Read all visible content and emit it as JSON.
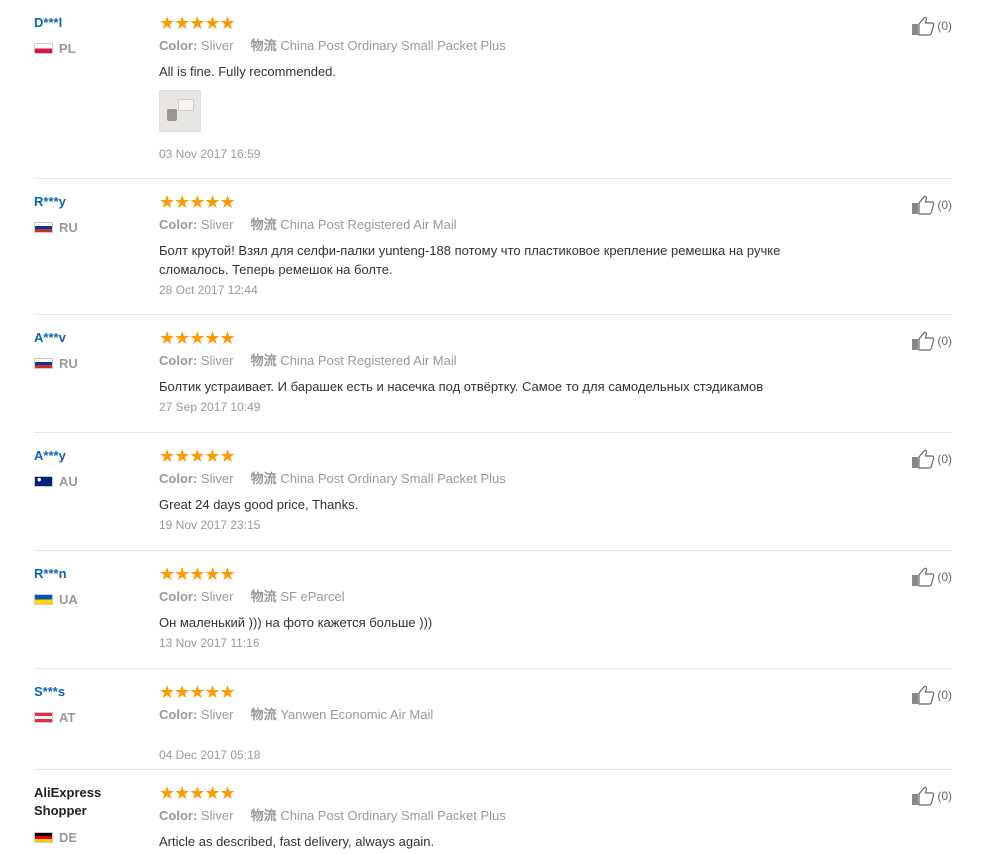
{
  "colors": {
    "username": "#0c64b4",
    "star": "#ff9a00",
    "muted": "#999999"
  },
  "reviews": [
    {
      "user": "D***l",
      "country": "PL",
      "flag": "pl",
      "stars": "★★★★★",
      "color_label": "Color:",
      "color_value": "Sliver",
      "logistics_label": "物流",
      "logistics_value": "China Post Ordinary Small Packet Plus",
      "text": "All is fine. Fully recommended.",
      "has_photo": true,
      "date": "03 Nov 2017 16:59",
      "likes": "(0)"
    },
    {
      "user": "R***y",
      "country": "RU",
      "flag": "ru",
      "stars": "★★★★★",
      "color_label": "Color:",
      "color_value": "Sliver",
      "logistics_label": "物流",
      "logistics_value": "China Post Registered Air Mail",
      "text": "Болт крутой! Взял для селфи-палки yunteng-188 потому что пластиковое крепление ремешка на ручке сломалось. Теперь ремешок на болте.",
      "date": "28 Oct 2017 12:44",
      "likes": "(0)"
    },
    {
      "user": "A***v",
      "country": "RU",
      "flag": "ru",
      "stars": "★★★★★",
      "color_label": "Color:",
      "color_value": "Sliver",
      "logistics_label": "物流",
      "logistics_value": "China Post Registered Air Mail",
      "text": "Болтик устраивает. И барашек есть и насечка под отвёртку. Самое то для самодельных стэдикамов",
      "date": "27 Sep 2017 10:49",
      "likes": "(0)"
    },
    {
      "user": "A***y",
      "country": "AU",
      "flag": "au",
      "stars": "★★★★★",
      "color_label": "Color:",
      "color_value": "Sliver",
      "logistics_label": "物流",
      "logistics_value": "China Post Ordinary Small Packet Plus",
      "text": "Great 24 days good price, Thanks.",
      "date": "19 Nov 2017 23:15",
      "likes": "(0)"
    },
    {
      "user": "R***n",
      "country": "UA",
      "flag": "ua",
      "stars": "★★★★★",
      "color_label": "Color:",
      "color_value": "Sliver",
      "logistics_label": "物流",
      "logistics_value": "SF eParcel",
      "text": "Он маленький ))) на фото кажется больше )))",
      "date": "13 Nov 2017 11:16",
      "likes": "(0)"
    },
    {
      "user": "S***s",
      "country": "AT",
      "flag": "at",
      "stars": "★★★★★",
      "color_label": "Color:",
      "color_value": "Sliver",
      "logistics_label": "物流",
      "logistics_value": "Yanwen Economic Air Mail",
      "text": "",
      "date": "04 Dec 2017 05:18",
      "likes": "(0)"
    },
    {
      "user": "AliExpress Shopper",
      "country": "DE",
      "flag": "de",
      "plain_name": true,
      "stars": "★★★★★",
      "color_label": "Color:",
      "color_value": "Sliver",
      "logistics_label": "物流",
      "logistics_value": "China Post Ordinary Small Packet Plus",
      "text": "Article as described, fast delivery, always again.",
      "date": "",
      "likes": "(0)"
    }
  ]
}
